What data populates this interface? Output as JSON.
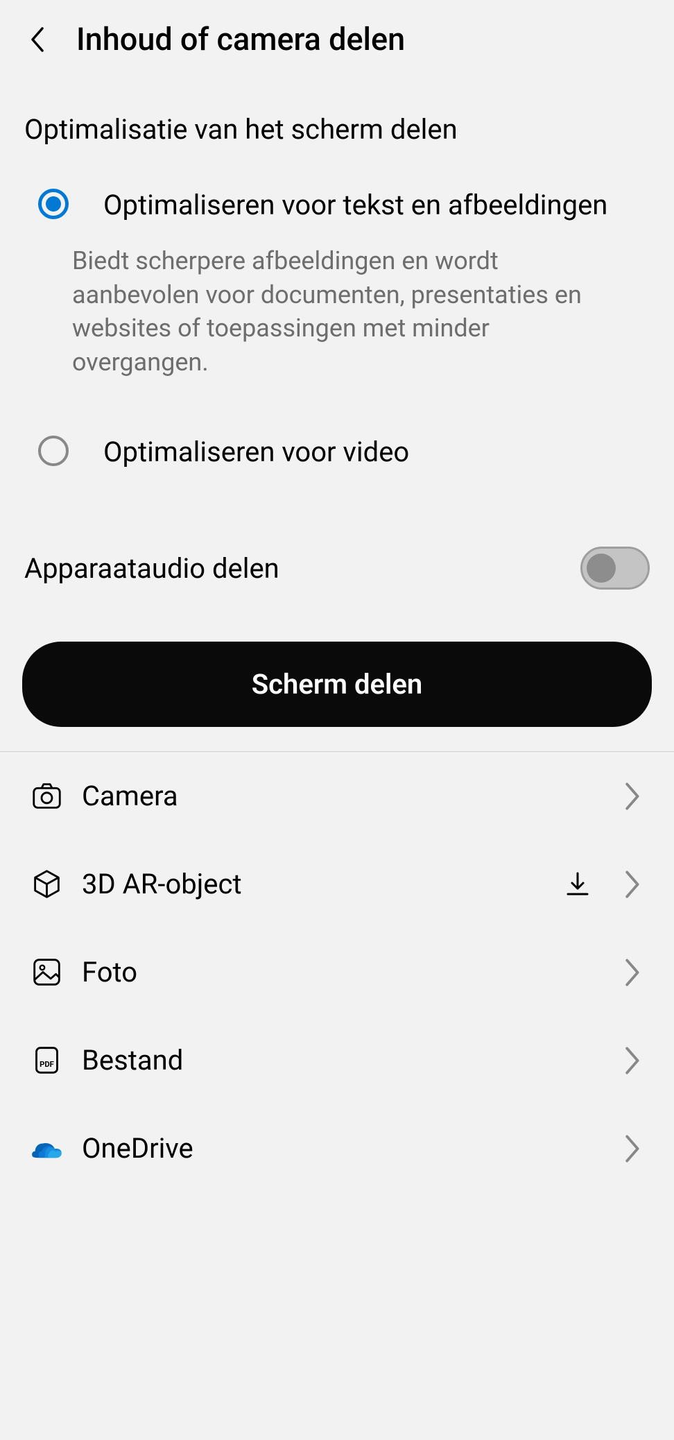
{
  "header": {
    "title": "Inhoud of camera delen"
  },
  "optimization": {
    "section_label": "Optimalisatie van het scherm delen",
    "options": [
      {
        "label": "Optimaliseren voor tekst en afbeeldingen",
        "description": "Biedt scherpere afbeeldingen en wordt aanbevolen voor documenten, presentaties en websites of toepassingen met minder overgangen.",
        "selected": true
      },
      {
        "label": "Optimaliseren voor video",
        "selected": false
      }
    ]
  },
  "audio_toggle": {
    "label": "Apparaataudio delen",
    "enabled": false
  },
  "primary_action": {
    "label": "Scherm delen"
  },
  "share_options": [
    {
      "label": "Camera",
      "icon": "camera-icon"
    },
    {
      "label": "3D AR-object",
      "icon": "cube-icon",
      "has_download": true
    },
    {
      "label": "Foto",
      "icon": "photo-icon"
    },
    {
      "label": "Bestand",
      "icon": "file-pdf-icon"
    },
    {
      "label": "OneDrive",
      "icon": "onedrive-icon"
    }
  ]
}
